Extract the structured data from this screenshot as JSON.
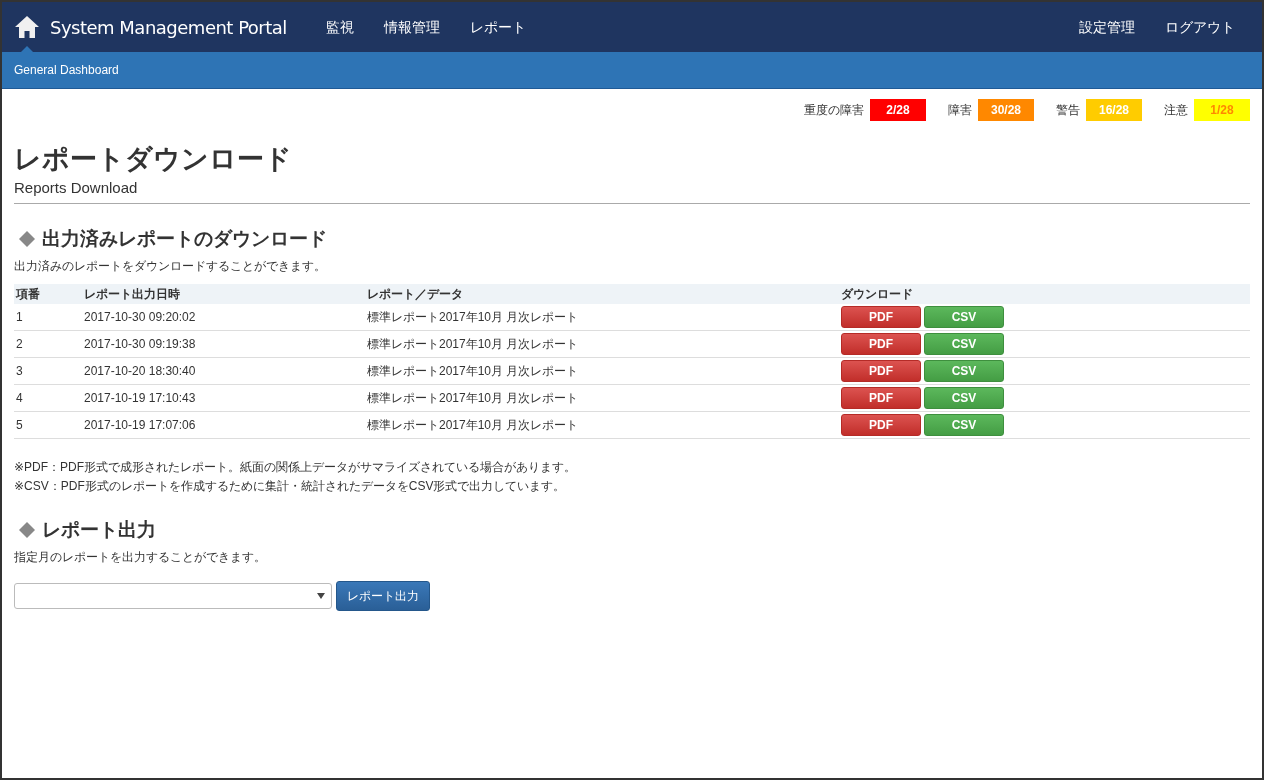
{
  "header": {
    "brand": "System Management Portal",
    "nav": [
      {
        "label": "監視",
        "selected": false
      },
      {
        "label": "情報管理",
        "selected": false
      },
      {
        "label": "レポート",
        "selected": false
      }
    ],
    "right_nav": [
      "設定管理",
      "ログアウト"
    ]
  },
  "sub_bar": {
    "title": "General Dashboard"
  },
  "alerts": [
    {
      "label": "重度の障害",
      "count": "2/28",
      "color": "#ff0000"
    },
    {
      "label": "障害",
      "count": "30/28",
      "color": "#ff8800"
    },
    {
      "label": "警告",
      "count": "16/28",
      "color": "#ffcc00"
    },
    {
      "label": "注意",
      "count": "1/28",
      "color": "#ffff00"
    }
  ],
  "page": {
    "title": "レポートダウンロード",
    "subtitle": "Reports Download"
  },
  "downloads": {
    "heading": "出力済みレポートのダウンロード",
    "description": "出力済みのレポートをダウンロードすることができます。",
    "columns": [
      "項番",
      "レポート出力日時",
      "レポート／データ",
      "ダウンロード"
    ],
    "rows": [
      {
        "no": "1",
        "datetime": "2017-10-30 09:20:02",
        "report": "標準レポート2017年10月 月次レポート",
        "buttons": [
          {
            "kind": "pdf",
            "label": "PDF"
          },
          {
            "kind": "csv",
            "label": "CSV"
          }
        ]
      },
      {
        "no": "2",
        "datetime": "2017-10-30 09:19:38",
        "report": "標準レポート2017年10月 月次レポート",
        "buttons": [
          {
            "kind": "pdf",
            "label": "PDF"
          },
          {
            "kind": "csv",
            "label": "CSV"
          }
        ]
      },
      {
        "no": "3",
        "datetime": "2017-10-20 18:30:40",
        "report": "標準レポート2017年10月 月次レポート",
        "buttons": [
          {
            "kind": "pdf",
            "label": "PDF"
          },
          {
            "kind": "csv",
            "label": "CSV"
          }
        ]
      },
      {
        "no": "4",
        "datetime": "2017-10-19 17:10:43",
        "report": "標準レポート2017年10月 月次レポート",
        "buttons": [
          {
            "kind": "pdf",
            "label": "PDF"
          },
          {
            "kind": "csv",
            "label": "CSV"
          }
        ]
      },
      {
        "no": "5",
        "datetime": "2017-10-19 17:07:06",
        "report": "標準レポート2017年10月 月次レポート",
        "buttons": [
          {
            "kind": "pdf",
            "label": "PDF"
          },
          {
            "kind": "csv",
            "label": "CSV"
          }
        ]
      }
    ],
    "notes": [
      "※PDF：PDF形式で成形されたレポート。紙面の関係上データがサマライズされている場合があります。",
      "※CSV：PDF形式のレポートを作成するために集計・統計されたデータをCSV形式で出力しています。"
    ]
  },
  "report_output": {
    "heading": "レポート出力",
    "description": "指定月のレポートを出力することができます。",
    "button": "レポート出力"
  }
}
